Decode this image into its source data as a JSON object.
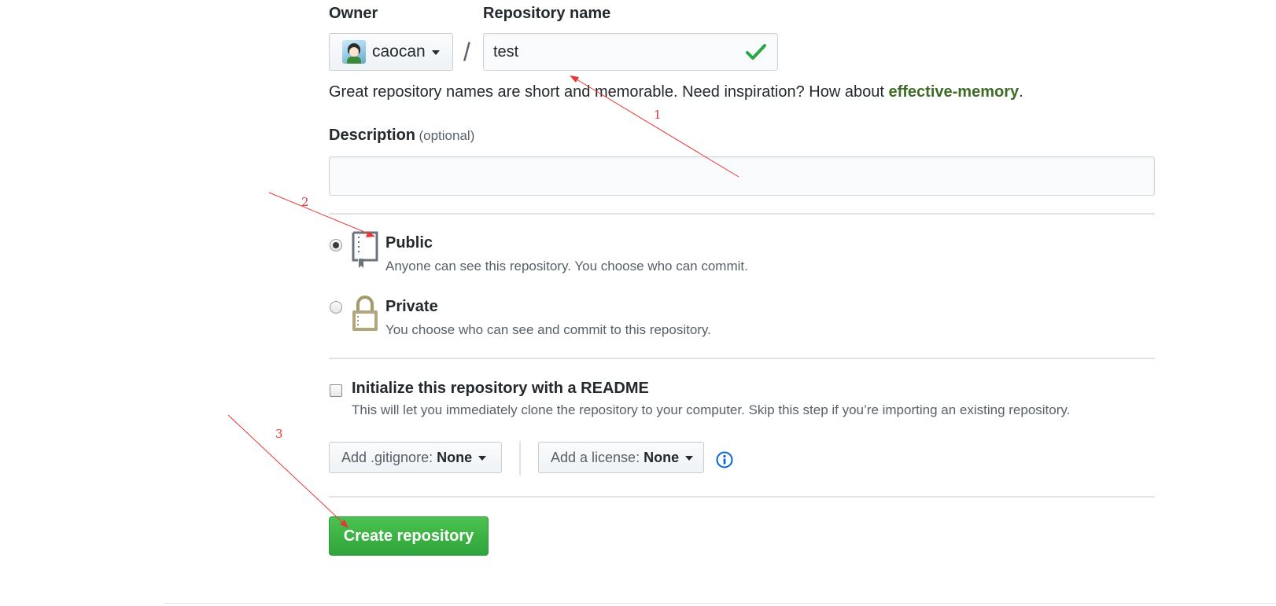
{
  "owner": {
    "label": "Owner",
    "username": "caocan"
  },
  "repo": {
    "label": "Repository name",
    "value": "test",
    "separator": "/",
    "hint_prefix": "Great repository names are short and memorable. Need inspiration? How about ",
    "hint_suggestion": "effective-memory",
    "hint_suffix": "."
  },
  "description": {
    "label": "Description",
    "optional": "(optional)",
    "value": ""
  },
  "visibility": {
    "public": {
      "title": "Public",
      "subtitle": "Anyone can see this repository. You choose who can commit.",
      "checked": true
    },
    "private": {
      "title": "Private",
      "subtitle": "You choose who can see and commit to this repository.",
      "checked": false
    }
  },
  "init": {
    "title": "Initialize this repository with a README",
    "subtitle": "This will let you immediately clone the repository to your computer. Skip this step if you’re importing an existing repository.",
    "checked": false
  },
  "gitignore": {
    "prefix": "Add .gitignore:",
    "value": "None"
  },
  "license": {
    "prefix": "Add a license:",
    "value": "None"
  },
  "create_label": "Create repository",
  "annotations": [
    "1",
    "2",
    "3"
  ],
  "colors": {
    "create_button": "#2ea43b",
    "suggestion": "#3e6b25",
    "annotation": "#e53935",
    "check": "#28a745",
    "info": "#0366d6"
  }
}
